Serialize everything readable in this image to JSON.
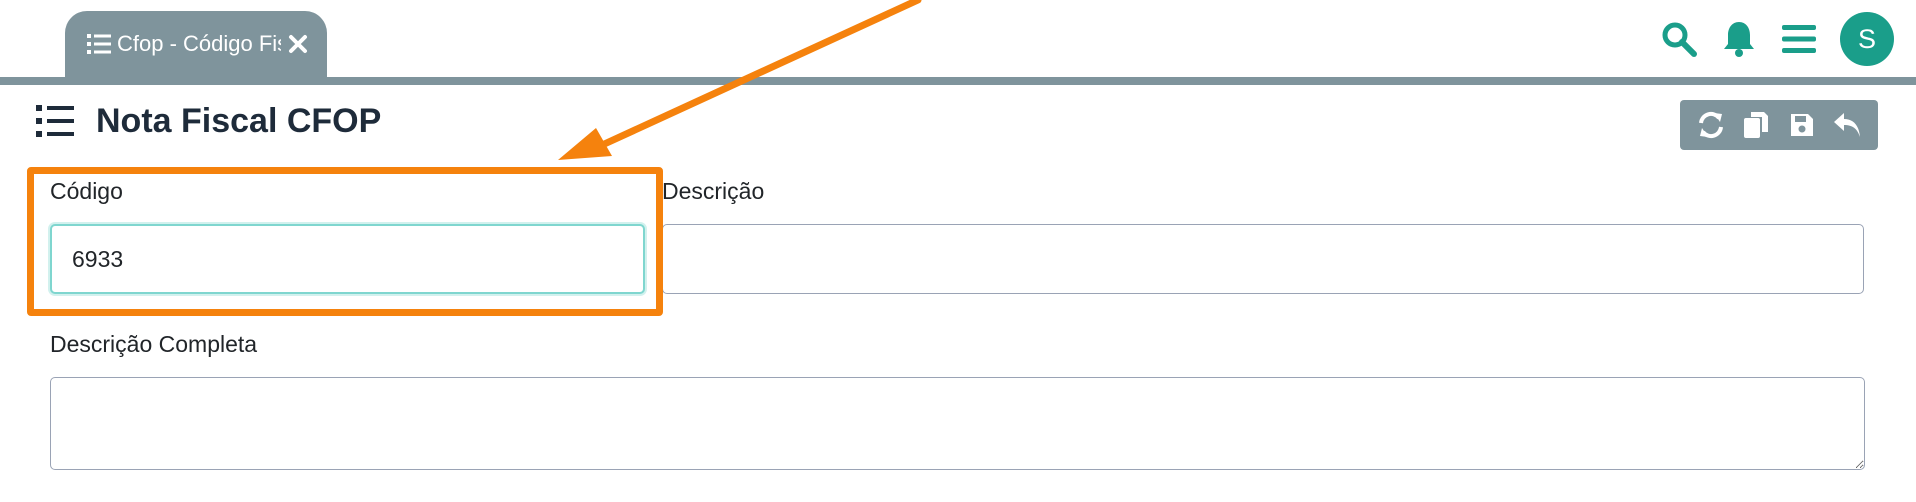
{
  "tab": {
    "label": "Cfop - Código Fiscal"
  },
  "header_icons": [
    "search-icon",
    "bell-icon",
    "hamburger-menu-icon"
  ],
  "user": {
    "initial": "S"
  },
  "page": {
    "title": "Nota Fiscal CFOP"
  },
  "toolbar": [
    "refresh-icon",
    "copy-icon",
    "save-icon",
    "undo-icon"
  ],
  "form": {
    "codigo": {
      "label": "Código",
      "value": "6933"
    },
    "descricao": {
      "label": "Descrição",
      "value": ""
    },
    "descricao_completa": {
      "label": "Descrição Completa",
      "value": ""
    }
  },
  "colors": {
    "accent": "#1a9e8a",
    "tab_bg": "#7f949c",
    "highlight": "#f5820d",
    "title": "#1e2b3a"
  }
}
